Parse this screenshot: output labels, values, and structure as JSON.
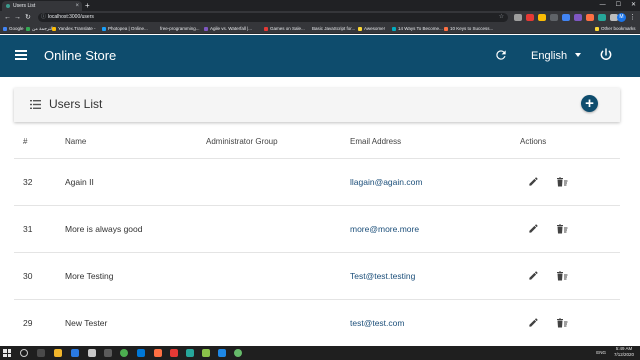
{
  "browser": {
    "tab_title": "Users List",
    "tab_close": "×",
    "new_tab": "+",
    "url": "localhost:3000/users",
    "bookmarks": [
      {
        "label": "Google",
        "color": "#4285f4"
      },
      {
        "label": "الترجمة من",
        "color": "#34a853"
      },
      {
        "label": "Yandex.Translate -",
        "color": "#fbbc05"
      },
      {
        "label": "Photopea | Online...",
        "color": "#18a0fb"
      },
      {
        "label": "free-programming...",
        "color": "#333333"
      },
      {
        "label": "Agile vs. Waterfall |...",
        "color": "#7e57c2"
      },
      {
        "label": "Games on Sale...",
        "color": "#e53935"
      },
      {
        "label": "Basic JavaScript for...",
        "color": "#616161"
      },
      {
        "label": "Awesome!",
        "color": "#fdd835"
      },
      {
        "label": "14 Ways To Become...",
        "color": "#00acc1"
      },
      {
        "label": "10 Keys to Success...",
        "color": "#ff7043"
      },
      {
        "label": "Other bookmarks",
        "color": "#fdd835"
      }
    ],
    "profile_initial": "M"
  },
  "appbar": {
    "title": "Online Store",
    "language": "English",
    "background": "#0e4c6d"
  },
  "card": {
    "title": "Users List",
    "add_label": "+"
  },
  "table": {
    "headers": [
      "#",
      "Name",
      "Administrator Group",
      "Email Address",
      "Actions"
    ],
    "rows": [
      {
        "id": "32",
        "name": "Again II",
        "group": "",
        "email": "llagain@again.com"
      },
      {
        "id": "31",
        "name": "More is always good",
        "group": "",
        "email": "more@more.more"
      },
      {
        "id": "30",
        "name": "More Testing",
        "group": "",
        "email": "Test@test.testing"
      },
      {
        "id": "29",
        "name": "New Tester",
        "group": "",
        "email": "test@test.com"
      }
    ]
  },
  "taskbar": {
    "time": "5:49 AM",
    "date": "7/12/2020",
    "lang": "ENG"
  }
}
